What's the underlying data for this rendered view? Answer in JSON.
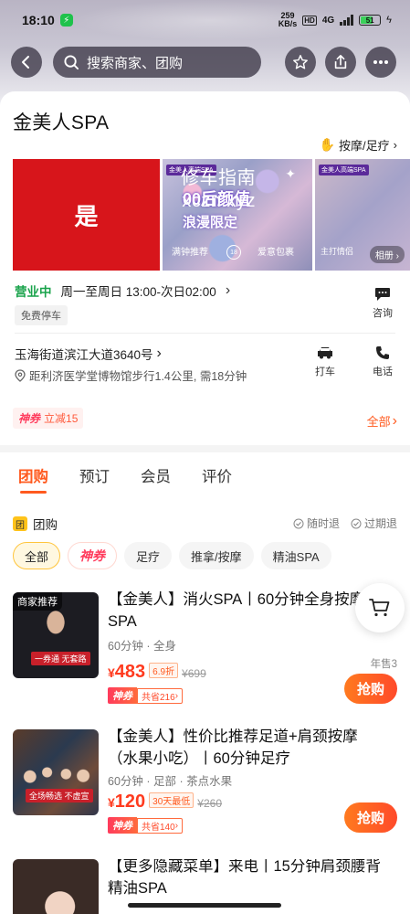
{
  "status_bar": {
    "time": "18:10",
    "net_speed_value": "259",
    "net_speed_unit": "KB/s",
    "hd": "HD",
    "network": "4G",
    "battery": "51"
  },
  "search": {
    "placeholder": "搜索商家、团购"
  },
  "store": {
    "name": "金美人SPA",
    "category": "按摩/足疗",
    "hours_status": "营业中",
    "hours": "周一至周日 13:00-次日02:00",
    "parking": "免费停车",
    "consult_label": "咨询",
    "address": "玉海街道滨江大道3640号",
    "distance": "距利济医学堂博物馆步行1.4公里, 需18分钟",
    "taxi_label": "打车",
    "phone_label": "电话"
  },
  "gallery": {
    "photo1_text": "是",
    "photo2_tag": "金美人高端SPA",
    "photo2_title1": "00后颜值",
    "photo2_title2": "浪漫限定",
    "photo2_foot_left": "满钟推荐",
    "photo2_badge": "18",
    "photo2_foot_right": "爱意包裹",
    "watermark_line1": "修车指南",
    "watermark_line2": "xczn.xyz",
    "photo3_tag": "金美人高端SPA",
    "photo3_foot": "主打情侣",
    "album_label": "相册"
  },
  "promo": {
    "shen": "神券",
    "text": "立减15",
    "all_label": "全部"
  },
  "tabs": [
    "团购",
    "预订",
    "会员",
    "评价"
  ],
  "section": {
    "icon": "团",
    "title": "团购",
    "policy1": "随时退",
    "policy2": "过期退"
  },
  "filters": [
    "全部",
    "神券",
    "足疗",
    "推拿/按摩",
    "精油SPA"
  ],
  "deals": [
    {
      "badge": "商家推荐",
      "strip": "一券通 无套路",
      "title": "【金美人】消火SPA丨60分钟全身按摩SPA",
      "meta": "60分钟 · 全身",
      "yen": "¥",
      "price": "483",
      "discount": "6.9折",
      "original": "¥699",
      "shen": "神券",
      "save": "共省216",
      "yearly": "年售3",
      "buy": "抢购"
    },
    {
      "badge": "",
      "strip": "全场畅选 不虚宣",
      "title": "【金美人】性价比推荐足道+肩颈按摩（水果小吃）丨60分钟足疗",
      "meta": "60分钟 · 足部 · 茶点水果",
      "yen": "¥",
      "price": "120",
      "discount": "30天最低",
      "original": "¥260",
      "shen": "神券",
      "save": "共省140",
      "yearly": "",
      "buy": "抢购"
    },
    {
      "title": "【更多隐藏菜单】来电丨15分钟肩颈腰背精油SPA"
    }
  ]
}
